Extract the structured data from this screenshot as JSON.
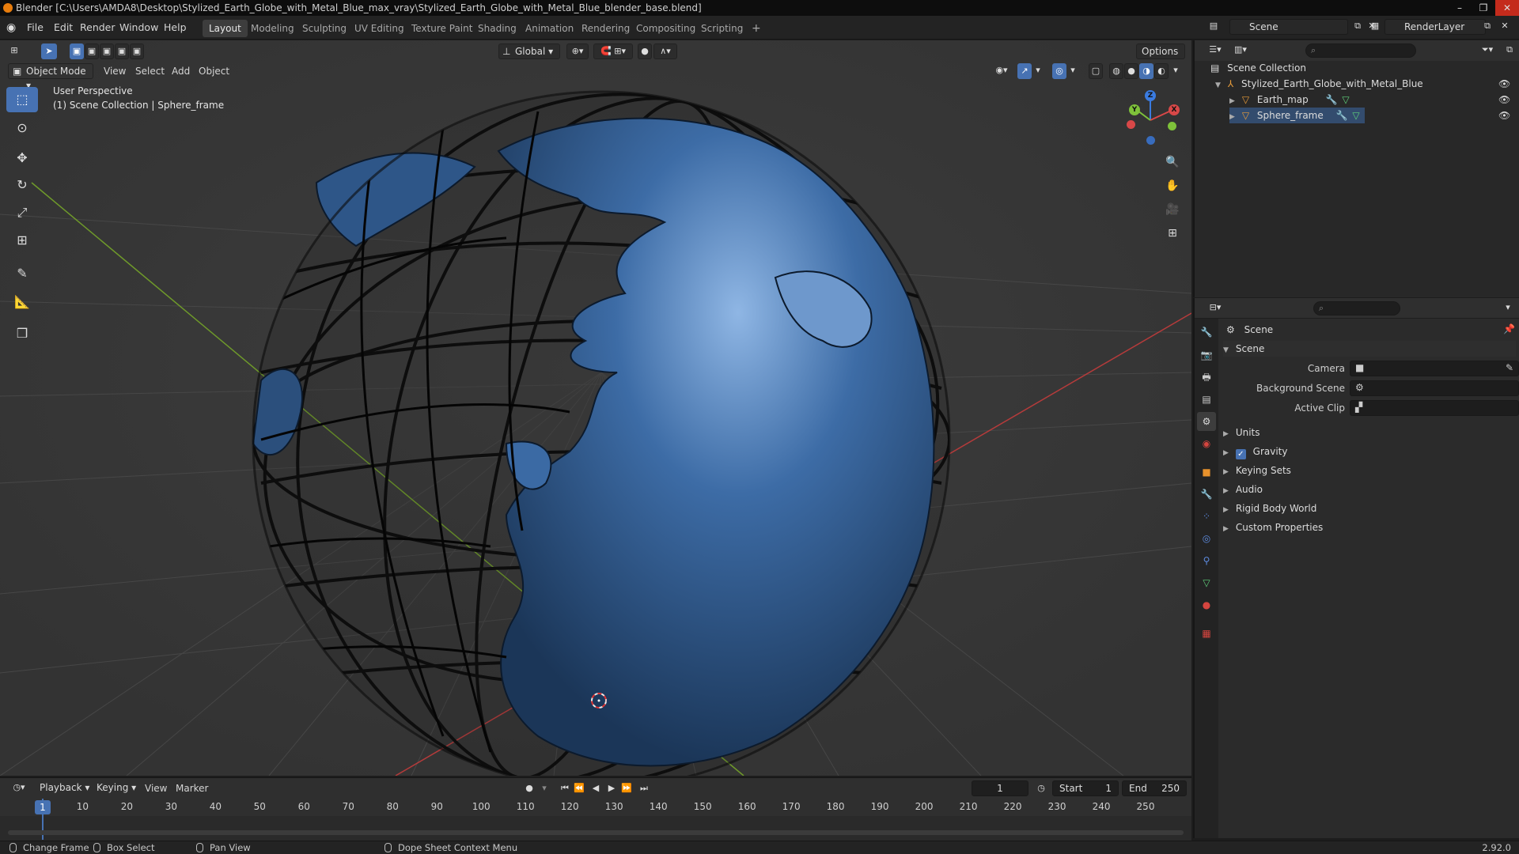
{
  "window": {
    "title": "Blender [C:\\Users\\AMDA8\\Desktop\\Stylized_Earth_Globe_with_Metal_Blue_max_vray\\Stylized_Earth_Globe_with_Metal_Blue_blender_base.blend]",
    "controls": [
      "–",
      "❐",
      "✕"
    ]
  },
  "menu": [
    "File",
    "Edit",
    "Render",
    "Window",
    "Help"
  ],
  "workspaces": [
    "Layout",
    "Modeling",
    "Sculpting",
    "UV Editing",
    "Texture Paint",
    "Shading",
    "Animation",
    "Rendering",
    "Compositing",
    "Scripting",
    "+"
  ],
  "active_workspace": "Layout",
  "scene_selector": {
    "scene": "Scene",
    "view_layer": "RenderLayer"
  },
  "viewport": {
    "mode": "Object Mode",
    "menus": [
      "View",
      "Select",
      "Add",
      "Object"
    ],
    "orientation": "Global",
    "options_label": "Options",
    "info_line1": "User Perspective",
    "info_line2": "(1) Scene Collection | Sphere_frame",
    "gizmo_axes": {
      "x": "X",
      "y": "Y",
      "z": "Z"
    },
    "colors": {
      "background": "#3a3a3a",
      "grid": "#444444",
      "x_axis": "#b53b3b",
      "y_axis": "#6f9a2a",
      "globe": "#2f5f9a"
    }
  },
  "outliner": {
    "search_placeholder": "",
    "root": "Scene Collection",
    "items": [
      {
        "name": "Stylized_Earth_Globe_with_Metal_Blue",
        "level": 1
      },
      {
        "name": "Earth_map",
        "level": 2
      },
      {
        "name": "Sphere_frame",
        "level": 2
      }
    ]
  },
  "properties": {
    "context": "Scene",
    "panel_title": "Scene",
    "fields": [
      {
        "label": "Camera",
        "value": ""
      },
      {
        "label": "Background Scene",
        "value": ""
      },
      {
        "label": "Active Clip",
        "value": ""
      }
    ],
    "sections": [
      "Units",
      "Gravity",
      "Keying Sets",
      "Audio",
      "Rigid Body World",
      "Custom Properties"
    ],
    "gravity_checked": true
  },
  "timeline": {
    "menus": [
      "Playback",
      "Keying",
      "View",
      "Marker"
    ],
    "current_frame": "1",
    "start_label": "Start",
    "start": "1",
    "end_label": "End",
    "end": "250",
    "ticks": [
      "1",
      "10",
      "20",
      "30",
      "40",
      "50",
      "60",
      "70",
      "80",
      "90",
      "100",
      "110",
      "120",
      "130",
      "140",
      "150",
      "160",
      "170",
      "180",
      "190",
      "200",
      "210",
      "220",
      "230",
      "240",
      "250"
    ]
  },
  "statusbar": {
    "items": [
      "Change Frame",
      "Box Select",
      "Pan View",
      "Dope Sheet Context Menu"
    ],
    "version": "2.92.0"
  }
}
